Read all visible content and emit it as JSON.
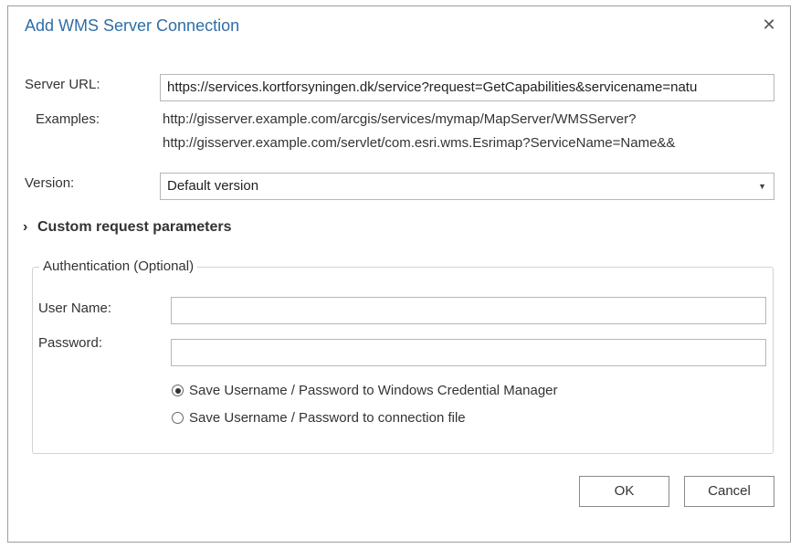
{
  "dialog": {
    "title": "Add WMS Server Connection",
    "close_glyph": "✕"
  },
  "server": {
    "label": "Server URL:",
    "value": "https://services.kortforsyningen.dk/service?request=GetCapabilities&servicename=natu"
  },
  "examples": {
    "label": "Examples:",
    "lines": [
      "http://gisserver.example.com/arcgis/services/mymap/MapServer/WMSServer?",
      "http://gisserver.example.com/servlet/com.esri.wms.Esrimap?ServiceName=Name&&"
    ]
  },
  "version": {
    "label": "Version:",
    "selected": "Default version",
    "caret_icon": "chevron-down-icon"
  },
  "custom_params": {
    "label": "Custom request parameters",
    "chevron_icon": "chevron-right-icon",
    "chevron_glyph": "›"
  },
  "auth": {
    "legend": "Authentication (Optional)",
    "username_label": "User Name:",
    "username_value": "",
    "password_label": "Password:",
    "password_value": "",
    "options": [
      {
        "label": "Save Username / Password to Windows Credential Manager",
        "checked": true
      },
      {
        "label": "Save Username / Password to connection file",
        "checked": false
      }
    ]
  },
  "buttons": {
    "ok": "OK",
    "cancel": "Cancel"
  }
}
